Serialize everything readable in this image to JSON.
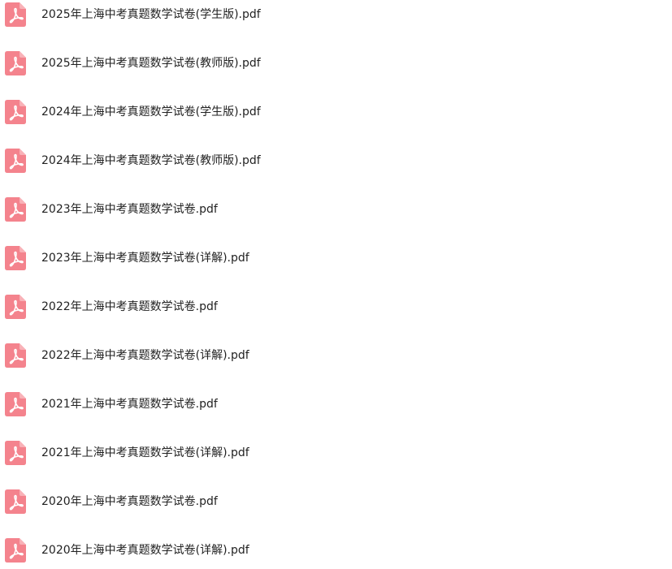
{
  "file_list": {
    "icon": "pdf-file-icon",
    "icon_color": "#f4838d",
    "icon_glyph_color": "#ffffff",
    "files": [
      {
        "name": "2025年上海中考真题数学试卷(学生版).pdf"
      },
      {
        "name": "2025年上海中考真题数学试卷(教师版).pdf"
      },
      {
        "name": "2024年上海中考真题数学试卷(学生版).pdf"
      },
      {
        "name": "2024年上海中考真题数学试卷(教师版).pdf"
      },
      {
        "name": "2023年上海中考真题数学试卷.pdf"
      },
      {
        "name": "2023年上海中考真题数学试卷(详解).pdf"
      },
      {
        "name": "2022年上海中考真题数学试卷.pdf"
      },
      {
        "name": "2022年上海中考真题数学试卷(详解).pdf"
      },
      {
        "name": "2021年上海中考真题数学试卷.pdf"
      },
      {
        "name": "2021年上海中考真题数学试卷(详解).pdf"
      },
      {
        "name": "2020年上海中考真题数学试卷.pdf"
      },
      {
        "name": "2020年上海中考真题数学试卷(详解).pdf"
      }
    ]
  }
}
